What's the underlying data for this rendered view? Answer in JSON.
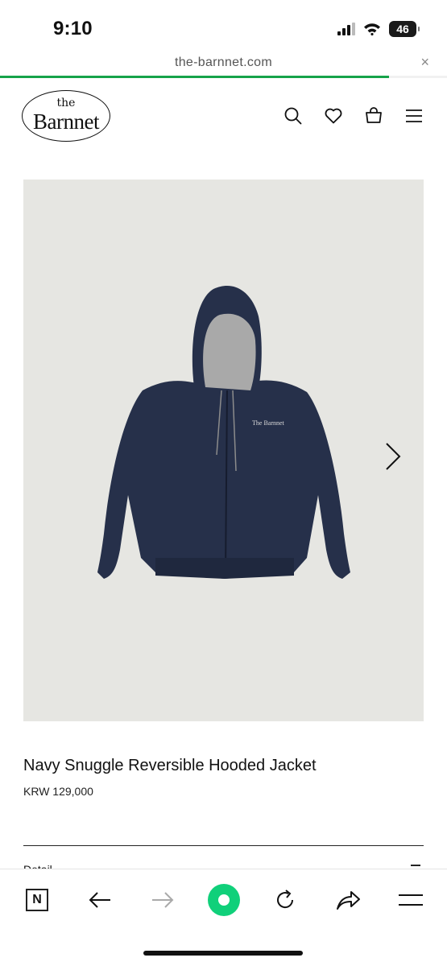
{
  "status_bar": {
    "time": "9:10",
    "battery": "46",
    "icons": [
      "cellular-signal-icon",
      "wifi-icon",
      "battery-icon"
    ]
  },
  "browser": {
    "url": "the-barnnet.com",
    "close_icon": "×",
    "load_progress": 0.87,
    "progress_color": "#16a34a"
  },
  "site": {
    "logo_top": "the",
    "logo_name": "Barnnet",
    "header_icons": [
      "search-icon",
      "heart-icon",
      "shopping-bag-icon",
      "menu-icon"
    ]
  },
  "product": {
    "image_logo_text": "The Barnnet",
    "title": "Navy Snuggle Reversible Hooded Jacket",
    "price": "KRW 129,000",
    "detail_label": "Detail",
    "jacket_color": "#26304a",
    "hood_lining_color": "#a9a9a9",
    "image_bg_color": "#e6e6e2"
  },
  "toolbar": {
    "items": [
      "tabs-icon",
      "back-icon",
      "forward-icon",
      "home-button-icon",
      "reload-icon",
      "share-icon",
      "menu-icon"
    ],
    "tabs_label": "N",
    "accent_color": "#10d07a"
  }
}
